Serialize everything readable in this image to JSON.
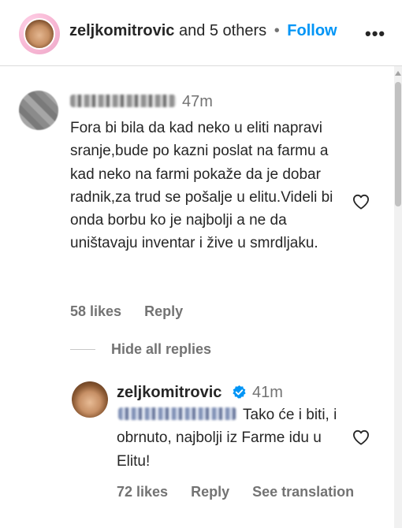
{
  "header": {
    "username": "zeljkomitrovic",
    "others_text": "and 5 others",
    "separator": "•",
    "follow_label": "Follow",
    "more_label": "•••"
  },
  "comment": {
    "time": "47m",
    "text": "Fora bi bila da kad neko u eliti napravi sranje,bude po kazni poslat na farmu a kad neko na farmi pokaže da je dobar radnik,za trud se pošalje u elitu.Videli bi onda borbu ko je najbolji a ne da uništavaju inventar i žive u smrdljaku.",
    "likes": "58 likes",
    "reply_label": "Reply"
  },
  "replies_toggle": {
    "label": "Hide all replies"
  },
  "reply": {
    "username": "zeljkomitrovic",
    "time": "41m",
    "text": "Tako će i biti, i obrnuto, najbolji iz Farme idu u Elitu!",
    "likes": "72 likes",
    "reply_label": "Reply",
    "translation_label": "See translation"
  },
  "colors": {
    "accent": "#0095f6",
    "secondary_text": "#737373",
    "verified": "#0095f6"
  },
  "icons": {
    "like": "heart-outline-icon",
    "verified": "verified-badge-icon",
    "more": "more-horizontal-icon"
  }
}
